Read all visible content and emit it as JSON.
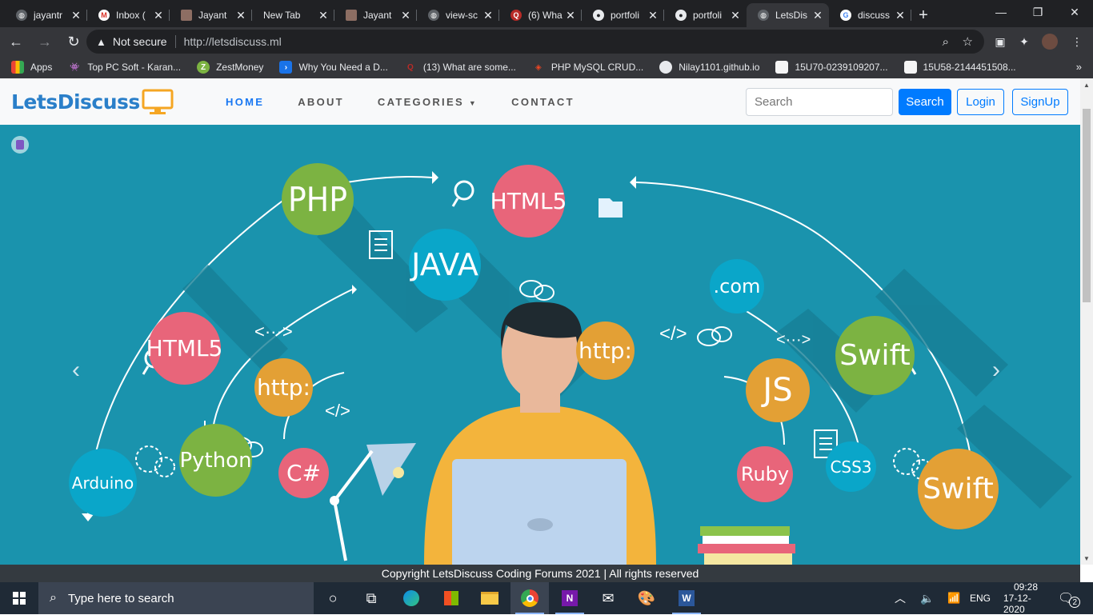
{
  "browser": {
    "tabs": [
      {
        "title": "jayantr",
        "icon": "globe-icon"
      },
      {
        "title": "Inbox (",
        "icon": "gmail-icon"
      },
      {
        "title": "Jayant",
        "icon": "avatar-icon"
      },
      {
        "title": "New Tab",
        "icon": ""
      },
      {
        "title": "Jayant",
        "icon": "avatar-icon"
      },
      {
        "title": "view-sc",
        "icon": "globe-icon"
      },
      {
        "title": "(6) Wha",
        "icon": "quora-icon"
      },
      {
        "title": "portfoli",
        "icon": "github-icon"
      },
      {
        "title": "portfoli",
        "icon": "github-icon"
      },
      {
        "title": "LetsDis",
        "icon": "globe-icon"
      },
      {
        "title": "discuss",
        "icon": "google-icon"
      }
    ],
    "active_tab_index": 9,
    "new_tab": "+",
    "window_controls": {
      "minimize": "—",
      "maximize": "❐",
      "close": "✕"
    },
    "address": {
      "security": "Not secure",
      "url": "http://letsdiscuss.ml"
    },
    "bookmarks": [
      {
        "label": "Apps",
        "icon": "apps-grid-icon"
      },
      {
        "label": "Top PC Soft - Karan...",
        "icon": "alien-icon"
      },
      {
        "label": "ZestMoney",
        "icon": "zestmoney-icon"
      },
      {
        "label": "Why You Need a D...",
        "icon": "bookmark-blue-icon"
      },
      {
        "label": "(13) What are some...",
        "icon": "quora-icon"
      },
      {
        "label": "PHP MySQL CRUD...",
        "icon": "codeigniter-icon"
      },
      {
        "label": "Nilay1101.github.io",
        "icon": "github-icon"
      },
      {
        "label": "15U70-0239109207...",
        "icon": "image-icon"
      },
      {
        "label": "15U58-2144451508...",
        "icon": "image-icon"
      }
    ],
    "bookmarks_more": "»"
  },
  "site": {
    "brand": "LetsDiscuss",
    "nav": [
      {
        "label": "HOME",
        "active": true
      },
      {
        "label": "ABOUT",
        "active": false
      },
      {
        "label": "CATEGORIES",
        "active": false,
        "dropdown": true
      },
      {
        "label": "CONTACT",
        "active": false
      }
    ],
    "search_placeholder": "Search",
    "search_button": "Search",
    "login_button": "Login",
    "signup_button": "SignUp",
    "hero": {
      "bubbles": [
        {
          "text": "PHP",
          "color": "#7cb342"
        },
        {
          "text": "HTML5",
          "color": "#e8657a"
        },
        {
          "text": "HTML5",
          "color": "#e8657a"
        },
        {
          "text": "JAVA",
          "color": "#0aa6c9"
        },
        {
          "text": "http:",
          "color": "#e3a035"
        },
        {
          "text": "http:",
          "color": "#e3a035"
        },
        {
          "text": ".com",
          "color": "#0aa6c9"
        },
        {
          "text": "Swift",
          "color": "#7cb342"
        },
        {
          "text": "JS",
          "color": "#e3a035"
        },
        {
          "text": "Python",
          "color": "#7cb342"
        },
        {
          "text": "C#",
          "color": "#e8657a"
        },
        {
          "text": "Arduino",
          "color": "#0aa6c9"
        },
        {
          "text": "Ruby",
          "color": "#e8657a"
        },
        {
          "text": "CSS3",
          "color": "#0aa6c9"
        },
        {
          "text": "Swift",
          "color": "#e3a035"
        }
      ],
      "code_tags": [
        "<···>",
        "</>",
        "</>",
        "</>",
        "<···>"
      ],
      "prev": "‹",
      "next": "›"
    },
    "footer": "Copyright LetsDiscuss Coding Forums 2021 | All rights reserved"
  },
  "taskbar": {
    "search_placeholder": "Type here to search",
    "lang": "ENG",
    "time": "09:28",
    "date": "17-12-2020",
    "notifications": "2"
  },
  "colors": {
    "hero_bg": "#1a93ad",
    "brand": "#2a7fc9",
    "primary": "#007bff"
  }
}
